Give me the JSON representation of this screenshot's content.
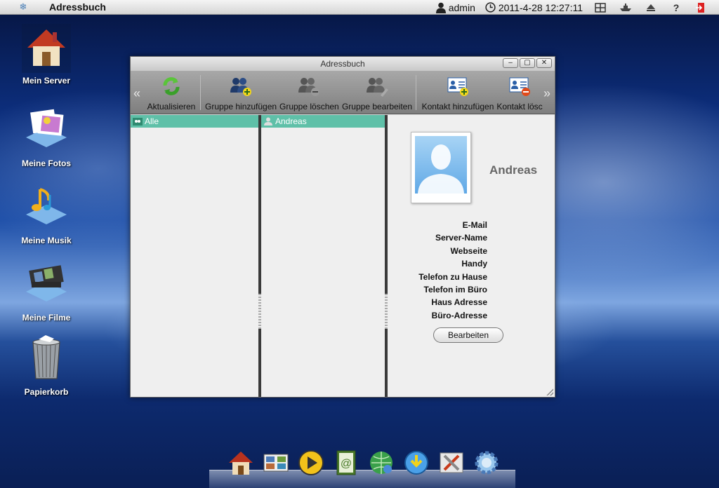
{
  "topbar": {
    "app_title": "Adressbuch",
    "user": "admin",
    "datetime": "2011-4-28 12:27:11"
  },
  "desktop": {
    "icons": [
      {
        "label": "Mein Server",
        "icon": "house-icon"
      },
      {
        "label": "Meine Fotos",
        "icon": "photos-icon"
      },
      {
        "label": "Meine Musik",
        "icon": "music-icon"
      },
      {
        "label": "Meine Filme",
        "icon": "film-icon"
      },
      {
        "label": "Papierkorb",
        "icon": "trash-icon"
      }
    ]
  },
  "window": {
    "title": "Adressbuch",
    "toolbar": {
      "refresh": "Aktualisieren",
      "add_group": "Gruppe hinzufügen",
      "delete_group": "Gruppe löschen",
      "edit_group": "Gruppe bearbeiten",
      "add_contact": "Kontakt hinzufügen",
      "delete_contact": "Kontakt lösc"
    },
    "groups": {
      "selected": "Alle"
    },
    "contacts": {
      "selected": "Andreas"
    },
    "detail": {
      "name": "Andreas",
      "fields": [
        "E-Mail",
        "Server-Name",
        "Webseite",
        "Handy",
        "Telefon zu Hause",
        "Telefon im Büro",
        "Haus Adresse",
        "Büro-Adresse"
      ],
      "edit_button": "Bearbeiten"
    }
  },
  "dock": {
    "items": [
      "house-icon",
      "photo-station-icon",
      "media-player-icon",
      "address-book-icon",
      "network-icon",
      "download-icon",
      "settings-tools-icon",
      "gear-icon"
    ]
  },
  "colors": {
    "selection": "#5fc0a8",
    "toolbar": "#8e8e8e",
    "desktop_blue": "#1e4fa8"
  }
}
